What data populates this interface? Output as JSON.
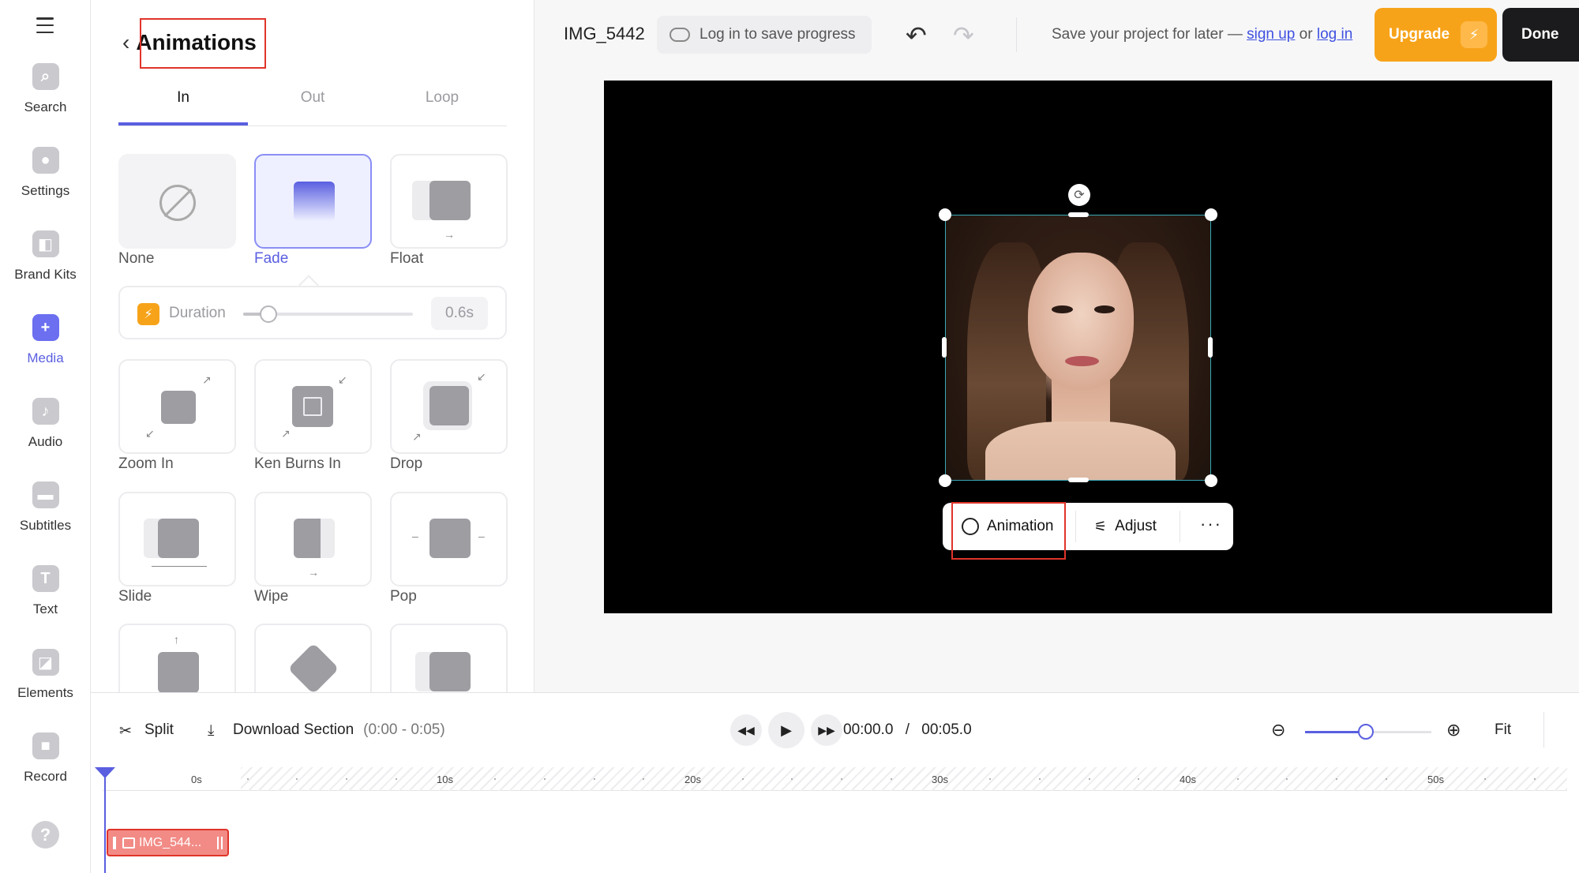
{
  "rail": {
    "items": [
      {
        "label": "Search",
        "icon": "search-icon"
      },
      {
        "label": "Settings",
        "icon": "gear-icon"
      },
      {
        "label": "Brand Kits",
        "icon": "brand-kit-icon"
      },
      {
        "label": "Media",
        "icon": "plus-icon",
        "active": true
      },
      {
        "label": "Audio",
        "icon": "music-note-icon"
      },
      {
        "label": "Subtitles",
        "icon": "subtitles-icon"
      },
      {
        "label": "Text",
        "icon": "text-icon"
      },
      {
        "label": "Elements",
        "icon": "elements-icon"
      },
      {
        "label": "Record",
        "icon": "camera-icon"
      }
    ],
    "help_glyph": "?"
  },
  "panel": {
    "title": "Animations",
    "tabs": [
      "In",
      "Out",
      "Loop"
    ],
    "active_tab": "In",
    "animations": [
      "None",
      "Fade",
      "Float",
      "Zoom In",
      "Ken Burns In",
      "Drop",
      "Slide",
      "Wipe",
      "Pop"
    ],
    "selected": "Fade",
    "duration": {
      "label": "Duration",
      "value": "0.6s",
      "level": 0.15
    }
  },
  "topbar": {
    "project_name": "IMG_5442",
    "login_save": "Log in to save progress",
    "save_msg_prefix": "Save your project for later — ",
    "sign_up": "sign up",
    "or": " or ",
    "log_in": "log in",
    "upgrade": "Upgrade",
    "done": "Done"
  },
  "context_toolbar": {
    "animation": "Animation",
    "adjust": "Adjust",
    "more": "···"
  },
  "timeline": {
    "split": "Split",
    "download": "Download Section",
    "range": "(0:00 - 0:05)",
    "current_time": "00:00.0",
    "separator": "/",
    "total_time": "00:05.0",
    "fit": "Fit",
    "zoom_level": 0.48,
    "ticks": [
      "0s",
      "10s",
      "20s",
      "30s",
      "40s",
      "50s"
    ],
    "clip_label": "IMG_544..."
  },
  "colors": {
    "accent": "#5a5fe0",
    "upgrade": "#f7a31a",
    "highlight_box": "#e0342a"
  }
}
